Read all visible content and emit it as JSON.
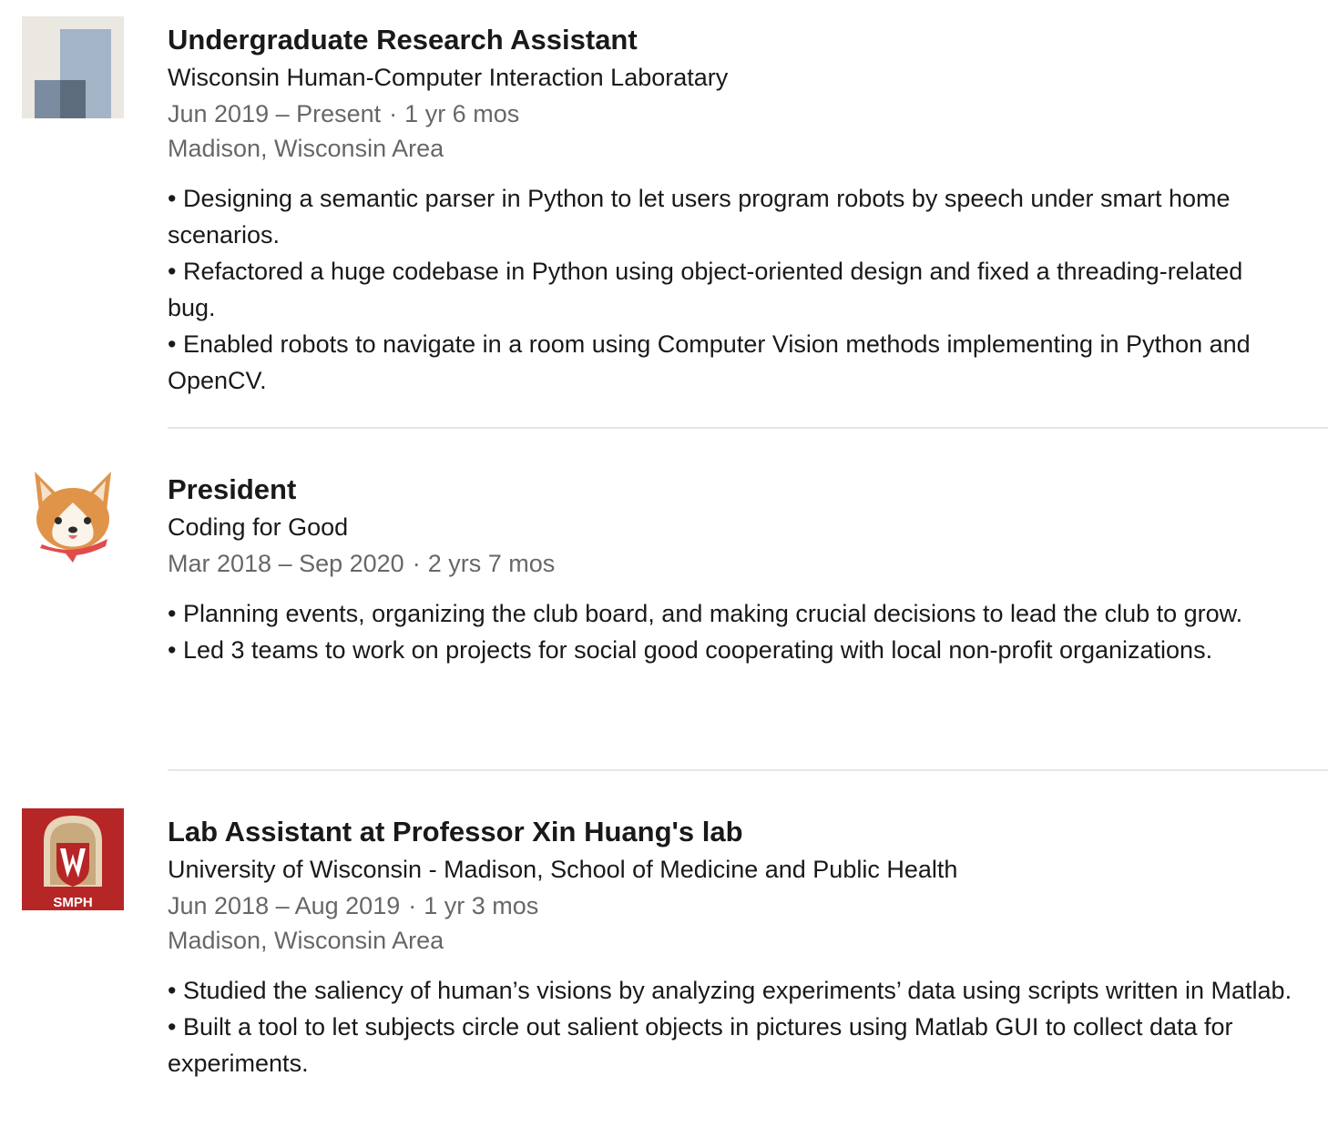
{
  "colors": {
    "text_primary": "#1f1f1f",
    "text_secondary": "#666666",
    "divider": "#e6e6e6",
    "smph_red": "#b62626",
    "generic_logo_bg": "#ebe7e1",
    "corgi_orange": "#e0944a",
    "bandana_red": "#e24b4b"
  },
  "experience": [
    {
      "title": "Undergraduate Research Assistant",
      "company": "Wisconsin Human-Computer Interaction Laboratary",
      "date_range": "Jun 2019 – Present",
      "separator": "·",
      "duration": "1 yr 6 mos",
      "location": "Madison, Wisconsin Area",
      "logo": "generic-company-icon",
      "bullets": [
        "• Designing a semantic parser in Python to let users program robots by speech under smart home scenarios.",
        "• Refactored a huge codebase in Python using object-oriented design and fixed a threading-related bug.",
        "• Enabled robots to navigate in a room using Computer Vision methods implementing in Python and OpenCV."
      ]
    },
    {
      "title": "President",
      "company": "Coding for Good",
      "date_range": "Mar 2018 – Sep 2020",
      "separator": "·",
      "duration": "2 yrs 7 mos",
      "location": "",
      "logo": "corgi-logo-icon",
      "bullets": [
        "• Planning events, organizing the club board, and making crucial decisions to lead the club to grow.",
        "• Led 3 teams to work on projects for social good cooperating with local non-profit organizations."
      ]
    },
    {
      "title": "Lab Assistant at Professor Xin Huang's lab",
      "company": "University of Wisconsin - Madison, School of Medicine and Public Health",
      "date_range": "Jun 2018 – Aug 2019",
      "separator": "·",
      "duration": "1 yr 3 mos",
      "location": "Madison, Wisconsin Area",
      "logo": "smph-logo-icon",
      "logo_text": "SMPH",
      "bullets": [
        "• Studied the saliency of human’s visions by analyzing experiments’ data using scripts written in Matlab.",
        "• Built a tool to let subjects circle out salient objects in pictures using Matlab GUI to collect data for experiments."
      ]
    }
  ]
}
